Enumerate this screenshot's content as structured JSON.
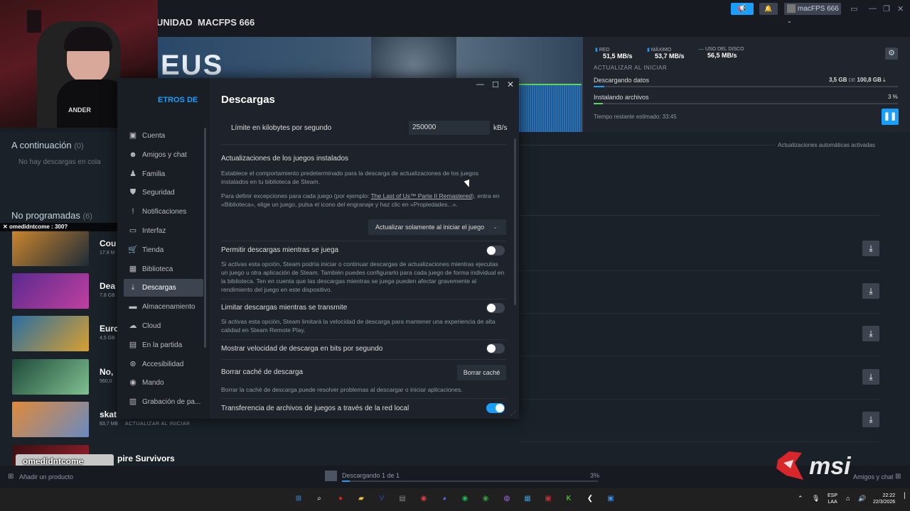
{
  "topnav": {
    "comunidad": "UNIDAD",
    "user": "MACFPS 666"
  },
  "topbar": {
    "username": "macFPS 666"
  },
  "stats": {
    "red_label": "RED",
    "red_value": "51,5 MB/s",
    "max_label": "MÁXIMO",
    "max_value": "53,7 MB/s",
    "disk_label": "USO DEL DISCO",
    "disk_value": "56,5 MB/s"
  },
  "update": {
    "label": "ACTUALIZAR AL INICIAR",
    "download_label": "Descargando datos",
    "download_amount": "3,5 GB",
    "download_sep": "DE",
    "download_total": "100,8 GB",
    "download_progress": 0.035,
    "install_label": "Instalando archivos",
    "install_pct": "3 %",
    "install_progress": 0.03,
    "remaining": "Tiempo restante estimado: 33:45"
  },
  "queue": {
    "title": "A continuación",
    "count": "(0)",
    "empty": "No hay descargas en cola",
    "unscheduled_title": "No programadas",
    "unscheduled_count": "(6)",
    "auto_updates": "Actualizaciones automáticas activadas"
  },
  "games": [
    {
      "name": "Cou",
      "size": "17.9 M",
      "color1": "#c9862e",
      "color2": "#1f2b38"
    },
    {
      "name": "Dea",
      "size": "7.8 GB",
      "color1": "#5a2a8e",
      "color2": "#c040a0"
    },
    {
      "name": "Euro",
      "size": "4,5 GB",
      "color1": "#2a6ea0",
      "color2": "#d8a030"
    },
    {
      "name": "No,",
      "size": "560,0",
      "color1": "#1e4a3a",
      "color2": "#80c090"
    },
    {
      "name": "skat",
      "size": "83,7 MB",
      "color1": "#e08a3a",
      "color2": "#6a8ac0",
      "extra": "ACTUALIZAR AL INICIAR"
    },
    {
      "name": "pire Survivors",
      "size": "",
      "color1": "#3a1010",
      "color2": "#a02030"
    }
  ],
  "chat": {
    "line": "omedidntcome : 300?",
    "bubble": "omedidntcome"
  },
  "settings": {
    "sidebar_title": "ETROS DE",
    "title": "Descargas",
    "sidebar": [
      {
        "label": "Cuenta",
        "icon": "▣"
      },
      {
        "label": "Amigos y chat",
        "icon": "☻"
      },
      {
        "label": "Familia",
        "icon": "♟"
      },
      {
        "label": "Seguridad",
        "icon": "⛊"
      },
      {
        "label": "Notificaciones",
        "icon": "!"
      },
      {
        "label": "Interfaz",
        "icon": "▭"
      },
      {
        "label": "Tienda",
        "icon": "🛒"
      },
      {
        "label": "Biblioteca",
        "icon": "▦"
      },
      {
        "label": "Descargas",
        "icon": "⤓"
      },
      {
        "label": "Almacenamiento",
        "icon": "▬"
      },
      {
        "label": "Cloud",
        "icon": "☁"
      },
      {
        "label": "En la partida",
        "icon": "▤"
      },
      {
        "label": "Accesibilidad",
        "icon": "⊛"
      },
      {
        "label": "Mando",
        "icon": "◉"
      },
      {
        "label": "Grabación de pa...",
        "icon": "▥"
      }
    ],
    "limit_label": "Límite en kilobytes por segundo",
    "limit_value": "250000",
    "limit_unit": "kB/s",
    "updates_title": "Actualizaciones de los juegos instalados",
    "updates_desc": "Establece el comportamiento predeterminado para la descarga de actualizaciones de los juegos instalados en tu biblioteca de Steam.",
    "updates_desc2_a": "Para definir excepciones para cada juego (por ejemplo: ",
    "updates_desc2_link": "The Last of Us™ Parte II Remastered",
    "updates_desc2_b": "), entra en «Biblioteca», elige un juego, pulsa el icono del engranaje y haz clic en «Propiedades...».",
    "updates_dropdown": "Actualizar solamente al iniciar el juego",
    "allow_label": "Permitir descargas mientras se juega",
    "allow_desc": "Si activas esta opción, Steam podría iniciar o continuar descargas de actualizaciones mientras ejecutas un juego u otra aplicación de Steam. También puedes configurarlo para cada juego de forma individual en la biblioteca. Ten en cuenta que las descargas mientras se juega pueden afectar gravemente al rendimiento del juego en este dispositivo.",
    "allow_on": false,
    "stream_label": "Limitar descargas mientras se transmite",
    "stream_desc": "Si activas esta opción, Steam limitará la velocidad de descarga para mantener una experiencia de alta calidad en Steam Remote Play.",
    "stream_on": false,
    "bits_label": "Mostrar velocidad de descarga en bits por segundo",
    "bits_on": false,
    "cache_label": "Borrar caché de descarga",
    "cache_button": "Borrar caché",
    "cache_desc": "Borrar la caché de descarga puede resolver problemas al descargar o iniciar aplicaciones.",
    "lan_label": "Transferencia de archivos de juegos a través de la red local",
    "lan_on": true
  },
  "statusbar": {
    "add_product": "Añadir un producto",
    "downloading": "Descargando 1 de 1",
    "pct": "3%",
    "progress": 0.03,
    "friends": "Amigos y chat"
  },
  "taskbar": {
    "lang1": "ESP",
    "lang2": "LAA",
    "time": "22:22",
    "date": "22/3/2026"
  },
  "colors": {
    "accent": "#1a9fff",
    "background": "#1b2129"
  }
}
